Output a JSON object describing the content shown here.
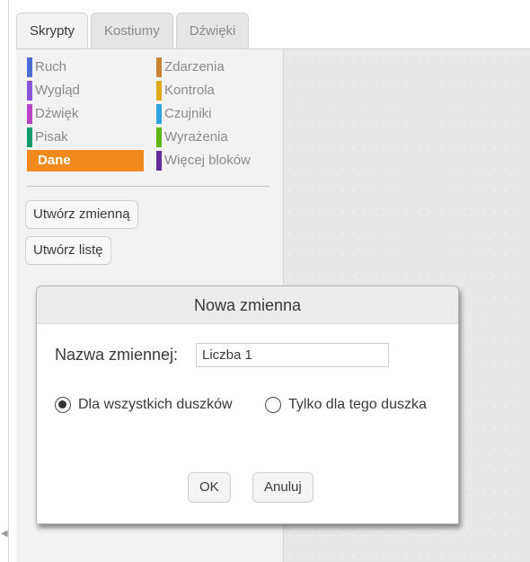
{
  "tabs": [
    {
      "label": "Skrypty",
      "active": true
    },
    {
      "label": "Kostiumy",
      "active": false
    },
    {
      "label": "Dźwięki",
      "active": false
    }
  ],
  "categories": [
    {
      "label": "Ruch",
      "color": "#4a6cd4"
    },
    {
      "label": "Zdarzenia",
      "color": "#c88330"
    },
    {
      "label": "Wygląd",
      "color": "#8a55d7"
    },
    {
      "label": "Kontrola",
      "color": "#e1a91a"
    },
    {
      "label": "Dźwięk",
      "color": "#bb42c3"
    },
    {
      "label": "Czujniki",
      "color": "#2ca5e2"
    },
    {
      "label": "Pisak",
      "color": "#0e9a6c"
    },
    {
      "label": "Wyrażenia",
      "color": "#5cb712"
    },
    {
      "label": "Dane",
      "color": "#ee7d16",
      "active": true
    },
    {
      "label": "Więcej bloków",
      "color": "#632d99"
    }
  ],
  "palette_buttons": {
    "make_variable": "Utwórz zmienną",
    "make_list": "Utwórz listę"
  },
  "dialog": {
    "title": "Nowa zmienna",
    "name_label": "Nazwa zmiennej:",
    "name_value": "Liczba 1",
    "radio_all": "Dla wszystkich duszków",
    "radio_this": "Tylko dla tego duszka",
    "selected": "all",
    "ok": "OK",
    "cancel": "Anuluj"
  }
}
